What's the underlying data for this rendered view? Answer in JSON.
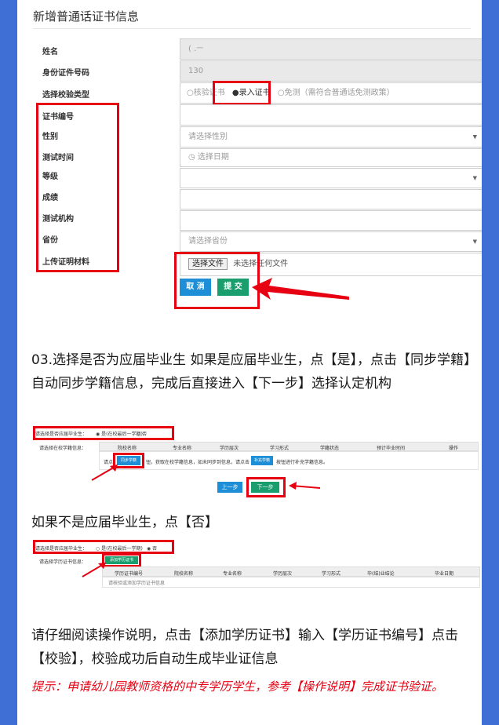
{
  "form": {
    "title": "新增普通话证书信息",
    "labels": {
      "name": "姓名",
      "id_number": "身份证件号码",
      "verify_type": "选择校验类型",
      "cert_no": "证书编号",
      "gender": "性别",
      "test_time": "测试时间",
      "level": "等级",
      "score": "成绩",
      "institution": "测试机构",
      "province": "省份",
      "upload": "上传证明材料"
    },
    "values": {
      "name": "( .ㅡ",
      "id_number": "130"
    },
    "verify_options": {
      "opt1": "○核验证书",
      "opt2": "●录入证书",
      "opt3": "○免测（需符合普通话免测政策）"
    },
    "placeholders": {
      "gender": "请选择性别",
      "date": "选择日期",
      "province": "请选择省份"
    },
    "file_button": "选择文件",
    "file_status": "未选择任何文件",
    "cancel": "取 消",
    "submit": "提 交"
  },
  "step3": {
    "text": "03.选择是否为应届毕业生 如果是应届毕业生，点【是】，点击【同步学籍】自动同步学籍信息，完成后直接进入【下一步】选择认定机构",
    "question": "请选择是否应届毕业生：",
    "yes_opt": "◉ 是(在校最后一学期)",
    "no_opt": "○ 否",
    "row_label": "请选择在校学籍信息：",
    "headers": [
      "院校名称",
      "专业名称",
      "学历层次",
      "学习形式",
      "学籍状态",
      "预计毕业时间",
      "操作"
    ],
    "sync_btn": "同步学籍",
    "hint_a": "请点",
    "hint_b": "钮，获取在校学籍信息，如未同步到信息，请点击",
    "add_btn": "补充学籍",
    "hint_c": "按钮进行补充学籍信息。",
    "prev": "上一步",
    "next": "下一步"
  },
  "step_no": {
    "text": "如果不是应届毕业生，点【否】",
    "question": "请选择是否应届毕业生：",
    "yes_opt": "○ 是(在校最后一学期)",
    "no_opt": "◉ 否",
    "row_label": "请选择学历证书信息：",
    "add_btn": "添加学历证书",
    "headers": [
      "学历证书编号",
      "院校名称",
      "专业名称",
      "学历层次",
      "学习形式",
      "毕(结)业结论",
      "毕业日期"
    ],
    "empty": "请核验或添加学历证书信息"
  },
  "instructions": "请仔细阅读操作说明，点击【添加学历证书】输入【学历证书编号】点击【校验】，校验成功后自动生成毕业证信息",
  "tip": "提示：申请幼儿园教师资格的中专学历学生，参考【操作说明】完成证书验证。",
  "colors": {
    "background": "#3f6fd4",
    "highlight": "#e60012",
    "blue": "#1e8fd6",
    "green": "#1a9e6e"
  }
}
